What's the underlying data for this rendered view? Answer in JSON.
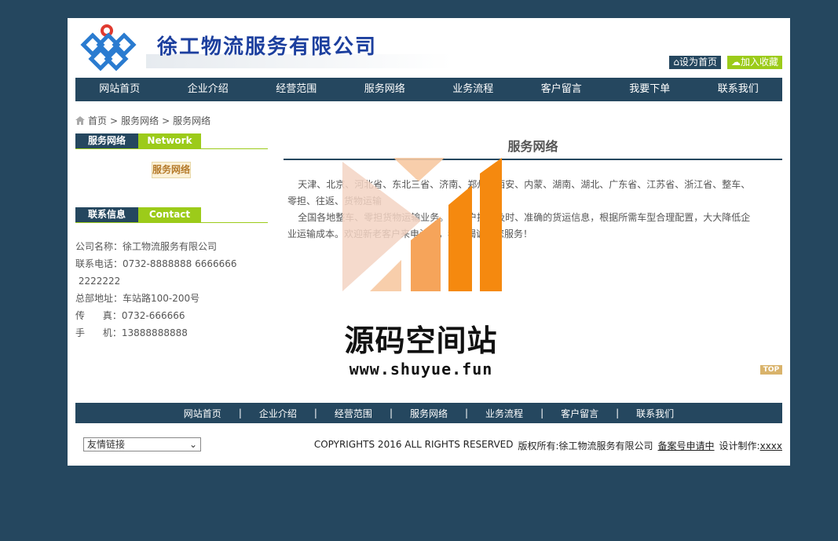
{
  "header": {
    "site_title": "徐工物流服务有限公司",
    "home_link": "设为首页",
    "fav_link": "加入收藏"
  },
  "nav": {
    "items": [
      "网站首页",
      "企业介绍",
      "经营范围",
      "服务网络",
      "业务流程",
      "客户留言",
      "我要下单",
      "联系我们"
    ]
  },
  "breadcrumb": {
    "home": "首页",
    "sep1": ">",
    "level1": "服务网络",
    "sep2": ">",
    "level2": "服务网络"
  },
  "sidebar": {
    "service_head_cn": "服务网络",
    "service_head_en": "Network",
    "service_link": "服务网络",
    "contact_head_cn": "联系信息",
    "contact_head_en": "Contact",
    "contact_lines": [
      "公司名称：徐工物流服务有限公司",
      "联系电话：0732-8888888  6666666",
      " 2222222",
      "总部地址：车站路100-200号",
      "传      真：0732-666666",
      "手      机：13888888888"
    ]
  },
  "main": {
    "title": "服务网络",
    "para1": "天津、北京、河北省、东北三省、济南、郑州、西安、内蒙、湖南、湖北、广东省、江苏省、浙江省、整车、零担、往返、货物运输",
    "para2": "全国各地整车、零担货物运输业务。为客户提供及时、准确的货运信息，根据所需车型合理配置，大大降低企业运输成本。欢迎新老客户来电洽谈，我们竭诚为您服务！"
  },
  "watermark": {
    "cn": "源码空间站",
    "url": "www.shuyue.fun"
  },
  "top_button": "TOP",
  "footer_nav": {
    "items": [
      "网站首页",
      "企业介绍",
      "经营范围",
      "服务网络",
      "业务流程",
      "客户留言",
      "联系我们"
    ],
    "separator": "|"
  },
  "footer": {
    "friend_links_select": "友情链接",
    "copyright": "COPYRIGHTS 2016  ALL RIGHTS RESERVED",
    "owner": "版权所有:徐工物流服务有限公司",
    "icp": "备案号申请中",
    "design_label": "设计制作:",
    "design_value": "xxxx"
  },
  "colors": {
    "navy": "#25475f",
    "accent_green": "#9ccb1a",
    "title_blue": "#1c3f9e",
    "watermark_orange": "#f5890f"
  }
}
